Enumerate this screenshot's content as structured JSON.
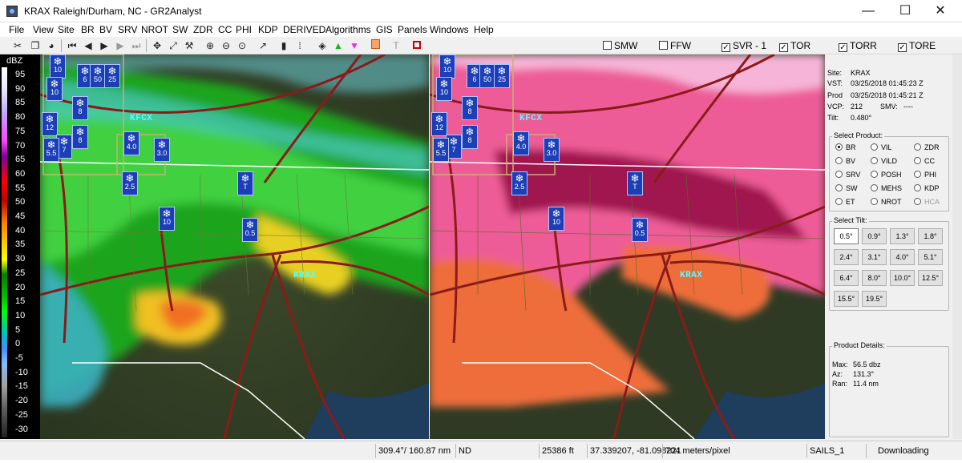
{
  "window": {
    "title": "KRAX Raleigh/Durham, NC - GR2Analyst",
    "minimize": "—",
    "maximize": "☐",
    "close": "✕"
  },
  "menu": [
    "File",
    "View",
    "Site",
    "BR",
    "BV",
    "SRV",
    "NROT",
    "SW",
    "ZDR",
    "CC",
    "PHI",
    "KDP",
    "DERIVED",
    "Algorithms",
    "GIS",
    "Panels",
    "Windows",
    "Help"
  ],
  "warnings": [
    {
      "label": "SMW",
      "checked": false
    },
    {
      "label": "FFW",
      "checked": false
    },
    {
      "label": "SVR - 1",
      "checked": true
    },
    {
      "label": "TOR",
      "checked": true
    },
    {
      "label": "TORR",
      "checked": true
    },
    {
      "label": "TORE",
      "checked": true
    }
  ],
  "scale": {
    "title": "dBZ",
    "ticks": [
      "95",
      "90",
      "85",
      "80",
      "75",
      "70",
      "65",
      "60",
      "55",
      "50",
      "45",
      "40",
      "35",
      "30",
      "25",
      "20",
      "15",
      "10",
      "5",
      "0",
      "-5",
      "-10",
      "-15",
      "-20",
      "-25",
      "-30"
    ]
  },
  "map": {
    "stations": [
      "KFCX",
      "KRAX",
      "KFCX",
      "KRAX"
    ],
    "winter_icons": [
      "10",
      "6",
      "50",
      "25",
      "10",
      "8",
      "12",
      "8",
      "7",
      "5.5",
      "4.0",
      "3.0",
      "2.5",
      "T",
      "10",
      "0.5"
    ]
  },
  "site_info": {
    "site_label": "Site:",
    "site": "KRAX",
    "vst_label": "VST:",
    "vst": "03/25/2018  01:45:23 Z",
    "prod_label": "Prod",
    "prod": "03/25/2018  01:45:21 Z",
    "vcp_label": "VCP:",
    "vcp": "212",
    "smv_label": "SMV:",
    "smv": "----",
    "tilt_label": "Tilt:",
    "tilt": "0.480°"
  },
  "select_product": {
    "title": "Select Product:",
    "options": [
      {
        "label": "BR",
        "selected": true,
        "disabled": false
      },
      {
        "label": "VIL",
        "selected": false,
        "disabled": false
      },
      {
        "label": "ZDR",
        "selected": false,
        "disabled": false
      },
      {
        "label": "BV",
        "selected": false,
        "disabled": false
      },
      {
        "label": "VILD",
        "selected": false,
        "disabled": false
      },
      {
        "label": "CC",
        "selected": false,
        "disabled": false
      },
      {
        "label": "SRV",
        "selected": false,
        "disabled": false
      },
      {
        "label": "POSH",
        "selected": false,
        "disabled": false
      },
      {
        "label": "PHI",
        "selected": false,
        "disabled": false
      },
      {
        "label": "SW",
        "selected": false,
        "disabled": false
      },
      {
        "label": "MEHS",
        "selected": false,
        "disabled": false
      },
      {
        "label": "KDP",
        "selected": false,
        "disabled": false
      },
      {
        "label": "ET",
        "selected": false,
        "disabled": false
      },
      {
        "label": "NROT",
        "selected": false,
        "disabled": false
      },
      {
        "label": "HCA",
        "selected": false,
        "disabled": true
      }
    ]
  },
  "select_tilt": {
    "title": "Select Tilt:",
    "tilts": [
      "0.5°",
      "0.9°",
      "1.3°",
      "1.8°",
      "2.4°",
      "3.1°",
      "4.0°",
      "5.1°",
      "6.4°",
      "8.0°",
      "10.0°",
      "12.5°",
      "15.5°",
      "19.5°"
    ],
    "selected": "0.5°"
  },
  "product_details": {
    "title": "Product Details:",
    "max_label": "Max:",
    "max": "56.5 dbz",
    "az_label": "Az:",
    "az": "131.3°",
    "ran_label": "Ran:",
    "ran": "11.4 nm"
  },
  "status": {
    "cursor_polar": "309.4°/ 160.87 nm",
    "nd": "ND",
    "height": "25386 ft",
    "latlon": "37.339207, -81.098221",
    "resolution": "704 meters/pixel",
    "mode": "SAILS_1",
    "state": "Downloading"
  },
  "colors": {
    "road": "#8b1a1a",
    "state_line": "#ffffff",
    "warning_outline": "#8b7a3a",
    "icon_fill": "#1c3fb8"
  }
}
